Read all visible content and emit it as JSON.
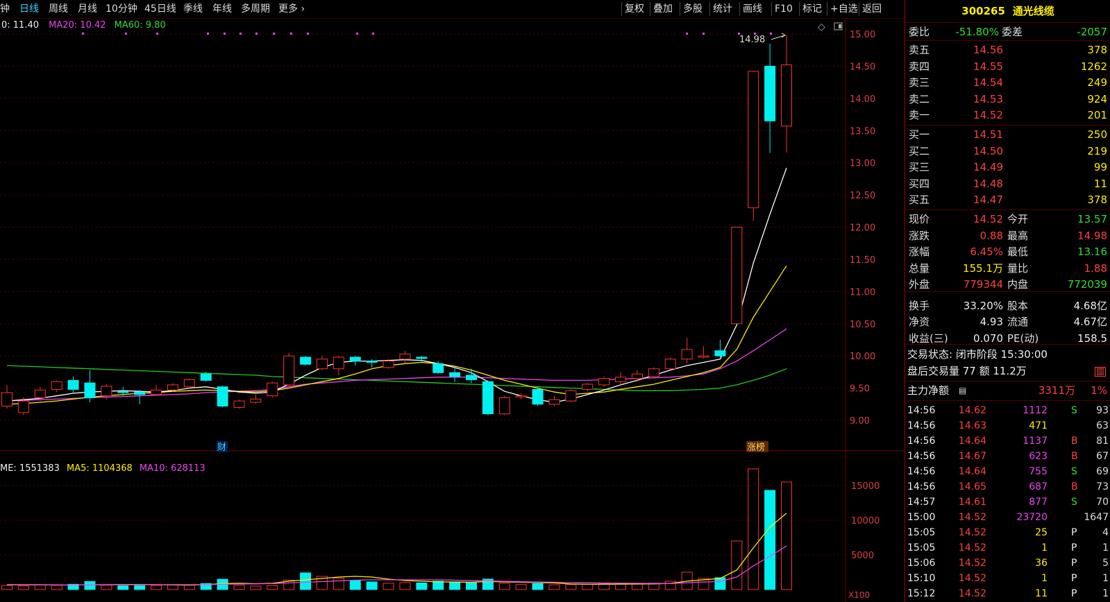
{
  "toolbar": {
    "left_items": [
      "钟",
      "日线",
      "周线",
      "月线",
      "10分钟",
      "45日线",
      "季线",
      "年线",
      "多周期",
      "更多 ›"
    ],
    "active_index": 1,
    "right_items": [
      "复权",
      "叠加",
      "多股",
      "统计",
      "画线",
      "F10",
      "标记",
      "+自选",
      "返回"
    ]
  },
  "ma_legend": {
    "ma10": "0: 11.40",
    "ma20": "MA20: 10.42",
    "ma60": "MA60: 9.80"
  },
  "vol_legend": {
    "vol": "ME: 1551383",
    "ma5": "MA5: 1104368",
    "ma10": "MA10: 628113"
  },
  "markers": {
    "cai": "财",
    "zhangbang": "涨榜",
    "high_label": "14.98",
    "x100": "X100"
  },
  "colors": {
    "up": "#ff3030",
    "down": "#00f0f0",
    "ma5": "#ffffff",
    "ma10": "#ffee00",
    "ma20": "#ee44ee",
    "ma60": "#22cc22",
    "grid": "#5a0000"
  },
  "chart_data": {
    "type": "candlestick",
    "price_axis": {
      "ylim": [
        8.85,
        15.05
      ],
      "ticks": [
        "15.00",
        "14.50",
        "14.00",
        "13.50",
        "13.00",
        "12.50",
        "12.00",
        "11.50",
        "11.00",
        "10.50",
        "10.00",
        "9.50",
        "9.00"
      ]
    },
    "volume_axis": {
      "ylim": [
        0,
        18000
      ],
      "ticks": [
        "15000",
        "10000",
        "5000"
      ],
      "unit": "X100"
    },
    "candles": [
      {
        "o": 9.22,
        "h": 9.55,
        "l": 9.18,
        "c": 9.43
      },
      {
        "o": 9.12,
        "h": 9.36,
        "l": 9.08,
        "c": 9.3
      },
      {
        "o": 9.35,
        "h": 9.52,
        "l": 9.3,
        "c": 9.47
      },
      {
        "o": 9.48,
        "h": 9.62,
        "l": 9.44,
        "c": 9.6
      },
      {
        "o": 9.62,
        "h": 9.68,
        "l": 9.42,
        "c": 9.48
      },
      {
        "o": 9.58,
        "h": 9.78,
        "l": 9.28,
        "c": 9.35
      },
      {
        "o": 9.38,
        "h": 9.56,
        "l": 9.32,
        "c": 9.53
      },
      {
        "o": 9.45,
        "h": 9.52,
        "l": 9.38,
        "c": 9.43
      },
      {
        "o": 9.44,
        "h": 9.47,
        "l": 9.25,
        "c": 9.4
      },
      {
        "o": 9.4,
        "h": 9.55,
        "l": 9.38,
        "c": 9.47
      },
      {
        "o": 9.47,
        "h": 9.58,
        "l": 9.45,
        "c": 9.55
      },
      {
        "o": 9.52,
        "h": 9.65,
        "l": 9.5,
        "c": 9.63
      },
      {
        "o": 9.72,
        "h": 9.75,
        "l": 9.6,
        "c": 9.62
      },
      {
        "o": 9.52,
        "h": 9.54,
        "l": 9.2,
        "c": 9.22
      },
      {
        "o": 9.2,
        "h": 9.32,
        "l": 9.18,
        "c": 9.3
      },
      {
        "o": 9.28,
        "h": 9.4,
        "l": 9.26,
        "c": 9.33
      },
      {
        "o": 9.38,
        "h": 9.6,
        "l": 9.35,
        "c": 9.58
      },
      {
        "o": 9.55,
        "h": 10.05,
        "l": 9.5,
        "c": 10.0
      },
      {
        "o": 9.98,
        "h": 10.0,
        "l": 9.85,
        "c": 9.87
      },
      {
        "o": 9.8,
        "h": 10.0,
        "l": 9.78,
        "c": 9.95
      },
      {
        "o": 9.8,
        "h": 10.0,
        "l": 9.7,
        "c": 9.98
      },
      {
        "o": 9.98,
        "h": 10.0,
        "l": 9.85,
        "c": 9.92
      },
      {
        "o": 9.92,
        "h": 9.95,
        "l": 9.82,
        "c": 9.9
      },
      {
        "o": 9.82,
        "h": 9.95,
        "l": 9.8,
        "c": 9.92
      },
      {
        "o": 9.95,
        "h": 10.08,
        "l": 9.88,
        "c": 10.03
      },
      {
        "o": 9.98,
        "h": 10.0,
        "l": 9.9,
        "c": 9.96
      },
      {
        "o": 9.88,
        "h": 9.92,
        "l": 9.72,
        "c": 9.74
      },
      {
        "o": 9.74,
        "h": 9.82,
        "l": 9.6,
        "c": 9.68
      },
      {
        "o": 9.7,
        "h": 9.8,
        "l": 9.58,
        "c": 9.63
      },
      {
        "o": 9.6,
        "h": 9.62,
        "l": 9.08,
        "c": 9.1
      },
      {
        "o": 9.1,
        "h": 9.38,
        "l": 9.08,
        "c": 9.35
      },
      {
        "o": 9.38,
        "h": 9.42,
        "l": 9.33,
        "c": 9.38
      },
      {
        "o": 9.48,
        "h": 9.5,
        "l": 9.22,
        "c": 9.25
      },
      {
        "o": 9.25,
        "h": 9.38,
        "l": 9.22,
        "c": 9.32
      },
      {
        "o": 9.3,
        "h": 9.48,
        "l": 9.28,
        "c": 9.46
      },
      {
        "o": 9.48,
        "h": 9.58,
        "l": 9.45,
        "c": 9.56
      },
      {
        "o": 9.55,
        "h": 9.68,
        "l": 9.52,
        "c": 9.65
      },
      {
        "o": 9.6,
        "h": 9.75,
        "l": 9.55,
        "c": 9.67
      },
      {
        "o": 9.65,
        "h": 9.78,
        "l": 9.6,
        "c": 9.72
      },
      {
        "o": 9.68,
        "h": 9.82,
        "l": 9.65,
        "c": 9.8
      },
      {
        "o": 9.8,
        "h": 9.98,
        "l": 9.78,
        "c": 9.95
      },
      {
        "o": 9.95,
        "h": 10.28,
        "l": 9.88,
        "c": 10.1
      },
      {
        "o": 9.98,
        "h": 10.15,
        "l": 9.96,
        "c": 10.0
      },
      {
        "o": 10.08,
        "h": 10.25,
        "l": 9.98,
        "c": 10.0
      },
      {
        "o": 10.5,
        "h": 12.0,
        "l": 10.5,
        "c": 12.0
      },
      {
        "o": 12.3,
        "h": 14.42,
        "l": 12.1,
        "c": 14.42
      },
      {
        "o": 14.5,
        "h": 14.85,
        "l": 13.15,
        "c": 13.65
      },
      {
        "o": 13.57,
        "h": 14.98,
        "l": 13.16,
        "c": 14.52
      }
    ],
    "volumes": [
      580,
      520,
      640,
      600,
      760,
      1150,
      620,
      540,
      560,
      600,
      690,
      640,
      860,
      1480,
      620,
      500,
      560,
      1350,
      2400,
      1900,
      1650,
      1300,
      1100,
      900,
      1000,
      950,
      1200,
      1100,
      980,
      1500,
      900,
      720,
      850,
      680,
      720,
      750,
      820,
      800,
      780,
      920,
      1200,
      2500,
      1600,
      1700,
      7000,
      17400,
      14300,
      15500
    ],
    "ma5": [
      9.3,
      9.32,
      9.34,
      9.38,
      9.42,
      9.44,
      9.45,
      9.46,
      9.45,
      9.44,
      9.46,
      9.5,
      9.52,
      9.48,
      9.44,
      9.42,
      9.44,
      9.56,
      9.7,
      9.82,
      9.9,
      9.92,
      9.92,
      9.93,
      9.94,
      9.93,
      9.88,
      9.82,
      9.74,
      9.6,
      9.45,
      9.38,
      9.32,
      9.28,
      9.33,
      9.4,
      9.47,
      9.55,
      9.62,
      9.7,
      9.78,
      9.85,
      9.9,
      9.95,
      10.48,
      11.44,
      12.2,
      12.92
    ],
    "ma10": [
      9.25,
      9.26,
      9.28,
      9.3,
      9.33,
      9.36,
      9.38,
      9.4,
      9.42,
      9.43,
      9.45,
      9.46,
      9.47,
      9.46,
      9.45,
      9.44,
      9.46,
      9.5,
      9.55,
      9.6,
      9.65,
      9.72,
      9.8,
      9.85,
      9.88,
      9.9,
      9.88,
      9.84,
      9.78,
      9.7,
      9.62,
      9.56,
      9.5,
      9.44,
      9.4,
      9.42,
      9.44,
      9.48,
      9.52,
      9.56,
      9.62,
      9.68,
      9.74,
      9.82,
      10.1,
      10.6,
      11.0,
      11.4
    ],
    "ma20": [
      9.3,
      9.31,
      9.32,
      9.33,
      9.34,
      9.35,
      9.36,
      9.37,
      9.38,
      9.39,
      9.4,
      9.41,
      9.43,
      9.44,
      9.45,
      9.46,
      9.48,
      9.52,
      9.56,
      9.58,
      9.6,
      9.62,
      9.63,
      9.64,
      9.65,
      9.66,
      9.67,
      9.67,
      9.67,
      9.66,
      9.65,
      9.64,
      9.63,
      9.62,
      9.62,
      9.62,
      9.63,
      9.64,
      9.65,
      9.66,
      9.67,
      9.69,
      9.72,
      9.8,
      9.92,
      10.08,
      10.25,
      10.42
    ],
    "ma60": [
      9.85,
      9.84,
      9.83,
      9.82,
      9.81,
      9.8,
      9.79,
      9.78,
      9.77,
      9.76,
      9.75,
      9.74,
      9.73,
      9.72,
      9.71,
      9.7,
      9.68,
      9.67,
      9.66,
      9.65,
      9.64,
      9.63,
      9.62,
      9.61,
      9.6,
      9.59,
      9.58,
      9.57,
      9.56,
      9.55,
      9.54,
      9.53,
      9.52,
      9.51,
      9.5,
      9.49,
      9.48,
      9.47,
      9.46,
      9.46,
      9.46,
      9.47,
      9.48,
      9.5,
      9.55,
      9.62,
      9.7,
      9.8
    ],
    "volma5": [
      700,
      690,
      680,
      660,
      640,
      680,
      700,
      720,
      740,
      700,
      660,
      640,
      700,
      860,
      900,
      850,
      900,
      1200,
      1400,
      1600,
      1800,
      1900,
      1800,
      1500,
      1300,
      1200,
      1100,
      1080,
      1050,
      1150,
      1100,
      1050,
      1000,
      950,
      800,
      760,
      760,
      780,
      800,
      820,
      880,
      1200,
      1400,
      1600,
      2800,
      6000,
      9000,
      11000
    ],
    "volma10": [
      650,
      650,
      650,
      660,
      660,
      670,
      680,
      690,
      700,
      700,
      700,
      700,
      700,
      760,
      800,
      820,
      850,
      950,
      1050,
      1150,
      1250,
      1350,
      1400,
      1400,
      1400,
      1400,
      1400,
      1350,
      1280,
      1230,
      1180,
      1120,
      1080,
      1050,
      1000,
      980,
      930,
      910,
      900,
      880,
      870,
      960,
      1080,
      1160,
      1800,
      3400,
      4800,
      6281
    ]
  },
  "quote": {
    "code": "300265",
    "name": "通光线缆",
    "weibi_label": "委比",
    "weibi": "-51.80%",
    "weicha_label": "委差",
    "weicha": "-2057",
    "asks": [
      {
        "label": "卖五",
        "price": "14.56",
        "vol": "378"
      },
      {
        "label": "卖四",
        "price": "14.55",
        "vol": "1262"
      },
      {
        "label": "卖三",
        "price": "14.54",
        "vol": "249"
      },
      {
        "label": "卖二",
        "price": "14.53",
        "vol": "924"
      },
      {
        "label": "卖一",
        "price": "14.52",
        "vol": "201"
      }
    ],
    "bids": [
      {
        "label": "买一",
        "price": "14.51",
        "vol": "250"
      },
      {
        "label": "买二",
        "price": "14.50",
        "vol": "219"
      },
      {
        "label": "买三",
        "price": "14.49",
        "vol": "99"
      },
      {
        "label": "买四",
        "price": "14.48",
        "vol": "11"
      },
      {
        "label": "买五",
        "price": "14.47",
        "vol": "378"
      }
    ],
    "stats": [
      {
        "l1": "现价",
        "v1": "14.52",
        "c1": "red",
        "l2": "今开",
        "v2": "13.57",
        "c2": "green"
      },
      {
        "l1": "涨跌",
        "v1": "0.88",
        "c1": "red",
        "l2": "最高",
        "v2": "14.98",
        "c2": "red"
      },
      {
        "l1": "涨幅",
        "v1": "6.45%",
        "c1": "red",
        "l2": "最低",
        "v2": "13.16",
        "c2": "green"
      },
      {
        "l1": "总量",
        "v1": "155.1万",
        "c1": "yellow",
        "l2": "量比",
        "v2": "1.88",
        "c2": "red"
      },
      {
        "l1": "外盘",
        "v1": "779344",
        "c1": "red",
        "l2": "内盘",
        "v2": "772039",
        "c2": "green"
      },
      {
        "l1": "换手",
        "v1": "33.20%",
        "c1": "white",
        "l2": "股本",
        "v2": "4.68亿",
        "c2": "white"
      },
      {
        "l1": "净资",
        "v1": "4.93",
        "c1": "white",
        "l2": "流通",
        "v2": "4.67亿",
        "c2": "white"
      },
      {
        "l1": "收益(三)",
        "v1": "0.070",
        "c1": "white",
        "l2": "PE(动)",
        "v2": "158.5",
        "c2": "white"
      }
    ],
    "trade_status": "交易状态: 闭市阶段 15:30:00",
    "after_hours": "盘后交易量 77 额 11.2万",
    "main_flow_label": "主力净额",
    "main_flow_value": "3311万",
    "main_flow_pct": "1%"
  },
  "ticks": [
    {
      "time": "14:56",
      "price": "14.62",
      "vol": "1112",
      "vc": "magenta",
      "side": "S",
      "sc": "green",
      "n": "93"
    },
    {
      "time": "14:56",
      "price": "14.63",
      "vol": "471",
      "vc": "yellow",
      "side": "",
      "sc": "white",
      "n": "63"
    },
    {
      "time": "14:56",
      "price": "14.64",
      "vol": "1137",
      "vc": "magenta",
      "side": "B",
      "sc": "red",
      "n": "81"
    },
    {
      "time": "14:56",
      "price": "14.67",
      "vol": "623",
      "vc": "magenta",
      "side": "B",
      "sc": "red",
      "n": "67"
    },
    {
      "time": "14:56",
      "price": "14.64",
      "vol": "755",
      "vc": "magenta",
      "side": "S",
      "sc": "green",
      "n": "69"
    },
    {
      "time": "14:56",
      "price": "14.65",
      "vol": "687",
      "vc": "magenta",
      "side": "B",
      "sc": "red",
      "n": "73"
    },
    {
      "time": "14:57",
      "price": "14.61",
      "vol": "877",
      "vc": "magenta",
      "side": "S",
      "sc": "green",
      "n": "70"
    },
    {
      "time": "15:00",
      "price": "14.52",
      "vol": "23720",
      "vc": "magenta",
      "side": "",
      "sc": "white",
      "n": "1647"
    },
    {
      "time": "15:05",
      "price": "14.52",
      "vol": "25",
      "vc": "yellow",
      "side": "P",
      "sc": "white",
      "n": "4"
    },
    {
      "time": "15:05",
      "price": "14.52",
      "vol": "1",
      "vc": "yellow",
      "side": "P",
      "sc": "white",
      "n": "1"
    },
    {
      "time": "15:06",
      "price": "14.52",
      "vol": "36",
      "vc": "yellow",
      "side": "P",
      "sc": "white",
      "n": "5"
    },
    {
      "time": "15:10",
      "price": "14.52",
      "vol": "1",
      "vc": "yellow",
      "side": "P",
      "sc": "white",
      "n": "1"
    },
    {
      "time": "15:12",
      "price": "14.52",
      "vol": "11",
      "vc": "yellow",
      "side": "P",
      "sc": "white",
      "n": "1"
    }
  ]
}
